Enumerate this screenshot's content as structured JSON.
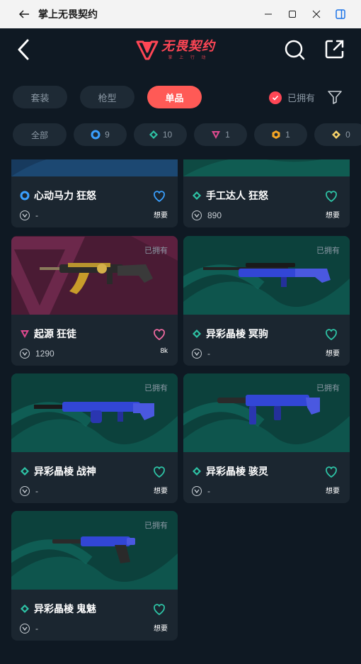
{
  "window": {
    "title": "掌上无畏契约"
  },
  "header": {
    "logo_title": "无畏契约",
    "logo_sub": "掌 上 行 动"
  },
  "tabs": [
    {
      "label": "套装",
      "active": false
    },
    {
      "label": "枪型",
      "active": false
    },
    {
      "label": "单品",
      "active": true
    }
  ],
  "owned_filter": {
    "label": "已拥有",
    "checked": true
  },
  "chips": [
    {
      "label": "全部",
      "icon": "none"
    },
    {
      "label": "9",
      "icon": "blue-circle"
    },
    {
      "label": "10",
      "icon": "green-diamond"
    },
    {
      "label": "1",
      "icon": "pink-triangle"
    },
    {
      "label": "1",
      "icon": "orange-hex"
    },
    {
      "label": "0",
      "icon": "gold-diamond"
    }
  ],
  "cards": [
    {
      "name": "心动马力 狂怒",
      "price": "-",
      "want": "想要",
      "owned": "",
      "rarity": "blue-circle",
      "heart_color": "#3aa0ff",
      "bg": "blue"
    },
    {
      "name": "手工达人 狂怒",
      "price": "890",
      "want": "想要",
      "owned": "",
      "rarity": "green-diamond",
      "heart_color": "#2ec4a6",
      "bg": "teal"
    },
    {
      "name": "起源 狂徒",
      "price": "1290",
      "want": "8k",
      "owned": "已拥有",
      "rarity": "pink-triangle",
      "heart_color": "#f06aa0",
      "bg": "pink"
    },
    {
      "name": "异彩晶棱 冥驹",
      "price": "-",
      "want": "想要",
      "owned": "已拥有",
      "rarity": "green-diamond",
      "heart_color": "#2ec4a6",
      "bg": "teal"
    },
    {
      "name": "异彩晶棱 战神",
      "price": "-",
      "want": "想要",
      "owned": "已拥有",
      "rarity": "green-diamond",
      "heart_color": "#2ec4a6",
      "bg": "teal"
    },
    {
      "name": "异彩晶棱 骇灵",
      "price": "-",
      "want": "想要",
      "owned": "已拥有",
      "rarity": "green-diamond",
      "heart_color": "#2ec4a6",
      "bg": "teal"
    },
    {
      "name": "异彩晶棱 鬼魅",
      "price": "-",
      "want": "想要",
      "owned": "已拥有",
      "rarity": "green-diamond",
      "heart_color": "#2ec4a6",
      "bg": "teal"
    }
  ],
  "colors": {
    "accent": "#ff4655",
    "bg": "#0f1923",
    "teal": "#2ec4a6"
  }
}
